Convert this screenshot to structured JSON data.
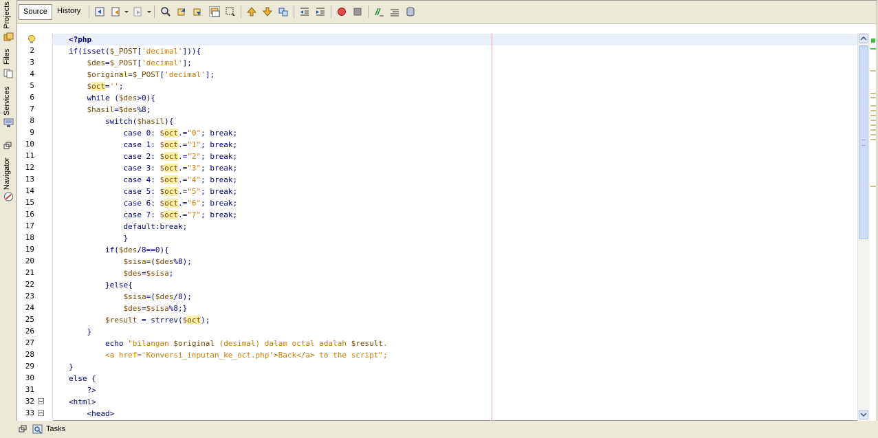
{
  "sidebar": {
    "tabs": [
      {
        "label": "Projects",
        "icon": "projects-icon"
      },
      {
        "label": "Files",
        "icon": "files-icon"
      },
      {
        "label": "Services",
        "icon": "services-icon"
      },
      {
        "label": "Navigator",
        "icon": "navigator-icon"
      }
    ]
  },
  "toolbar": {
    "source_label": "Source",
    "history_label": "History"
  },
  "editor": {
    "visible_lines": [
      {
        "n": "",
        "text": "<?php"
      },
      {
        "n": "2",
        "text": "if(isset($_POST['decimal'])){"
      },
      {
        "n": "3",
        "text": "    $des=$_POST['decimal'];"
      },
      {
        "n": "4",
        "text": "    $original=$_POST['decimal'];"
      },
      {
        "n": "5",
        "text": "    $oct='';"
      },
      {
        "n": "6",
        "text": "    while ($des>0){"
      },
      {
        "n": "7",
        "text": "    $hasil=$des%8;"
      },
      {
        "n": "8",
        "text": "        switch($hasil){"
      },
      {
        "n": "9",
        "text": "            case 0: $oct.=\"0\"; break;"
      },
      {
        "n": "10",
        "text": "            case 1: $oct.=\"1\"; break;"
      },
      {
        "n": "11",
        "text": "            case 2: $oct.=\"2\"; break;"
      },
      {
        "n": "12",
        "text": "            case 3: $oct.=\"3\"; break;"
      },
      {
        "n": "13",
        "text": "            case 4: $oct.=\"4\"; break;"
      },
      {
        "n": "14",
        "text": "            case 5: $oct.=\"5\"; break;"
      },
      {
        "n": "15",
        "text": "            case 6: $oct.=\"6\"; break;"
      },
      {
        "n": "16",
        "text": "            case 7: $oct.=\"7\"; break;"
      },
      {
        "n": "17",
        "text": "            default:break;"
      },
      {
        "n": "18",
        "text": "            }"
      },
      {
        "n": "19",
        "text": "        if($des/8==0){"
      },
      {
        "n": "20",
        "text": "            $sisa=($des%8);"
      },
      {
        "n": "21",
        "text": "            $des=$sisa;"
      },
      {
        "n": "22",
        "text": "        }else{"
      },
      {
        "n": "23",
        "text": "            $sisa=($des/8);"
      },
      {
        "n": "24",
        "text": "            $des=$sisa%8;}"
      },
      {
        "n": "25",
        "text": "        $result = strrev($oct);"
      },
      {
        "n": "26",
        "text": "    }"
      },
      {
        "n": "27",
        "text": "        echo \"bilangan $original (desimal) dalam octal adalah $result."
      },
      {
        "n": "28",
        "text": "        <a href='Konversi_inputan_ke_oct.php'>Back</a> to the script\";"
      },
      {
        "n": "29",
        "text": "}"
      },
      {
        "n": "30",
        "text": "else {"
      },
      {
        "n": "31",
        "text": "    ?>"
      },
      {
        "n": "32",
        "text": "<html>"
      },
      {
        "n": "33",
        "text": "    <head>"
      }
    ]
  },
  "bottombar": {
    "tasks_label": "Tasks"
  },
  "colors": {
    "keyword": "#000080",
    "variable": "#7a4b00",
    "string": "#ce7b00",
    "occurrence_highlight": "#fbf0a8",
    "current_line": "#e9eff8",
    "right_margin": "#f3a6a6"
  }
}
